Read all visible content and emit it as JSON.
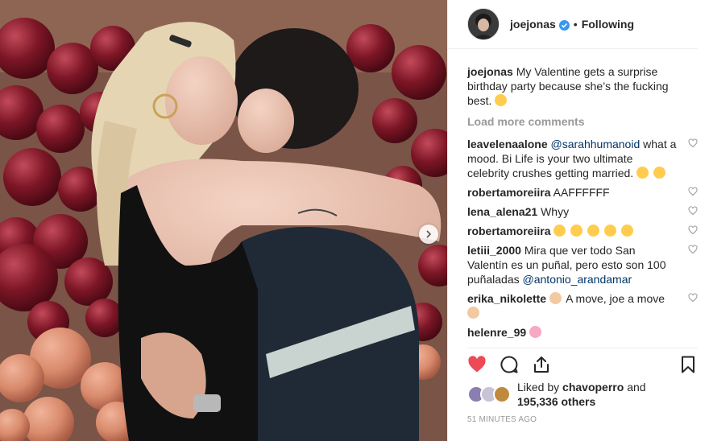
{
  "header": {
    "username": "joejonas",
    "separator": "•",
    "follow_status": "Following"
  },
  "caption": {
    "username": "joejonas",
    "text": "My Valentine gets a surprise birthday party because she’s the fucking best."
  },
  "load_more": "Load more comments",
  "comments": [
    {
      "username": "leavelenaalone",
      "mention": "@sarahhumanoid",
      "text": "what a mood. Bi Life is your two ultimate celebrity crushes getting married.",
      "emoji": [
        "weary-face"
      ]
    },
    {
      "username": "robertamoreiira",
      "text": "AAFFFFFF"
    },
    {
      "username": "lena_alena21",
      "text": "Whyy"
    },
    {
      "username": "robertamoreiira",
      "text": "",
      "emoji": [
        "heart-eyes",
        "heart-eyes",
        "heart-eyes",
        "heart-eyes",
        "heart-eyes"
      ]
    },
    {
      "username": "letiii_2000",
      "text": "Mira que ver todo San Valentín es un puñal, pero esto son 100 puñaladas",
      "mention": "@antonio_arandamar"
    },
    {
      "username": "erika_nikolette",
      "text": "A move, joe a move",
      "emoji": [
        "clapping-hands"
      ]
    },
    {
      "username": "helenre_99",
      "text": ""
    }
  ],
  "likes": {
    "prefix": "Liked by",
    "user": "chavoperro",
    "and": "and",
    "count": "195,336 others"
  },
  "timestamp": "51 MINUTES AGO",
  "colors": {
    "like_red": "#ed4956",
    "verified_blue": "#3897f0",
    "mention_blue": "#003569",
    "muted_gray": "#999999"
  }
}
